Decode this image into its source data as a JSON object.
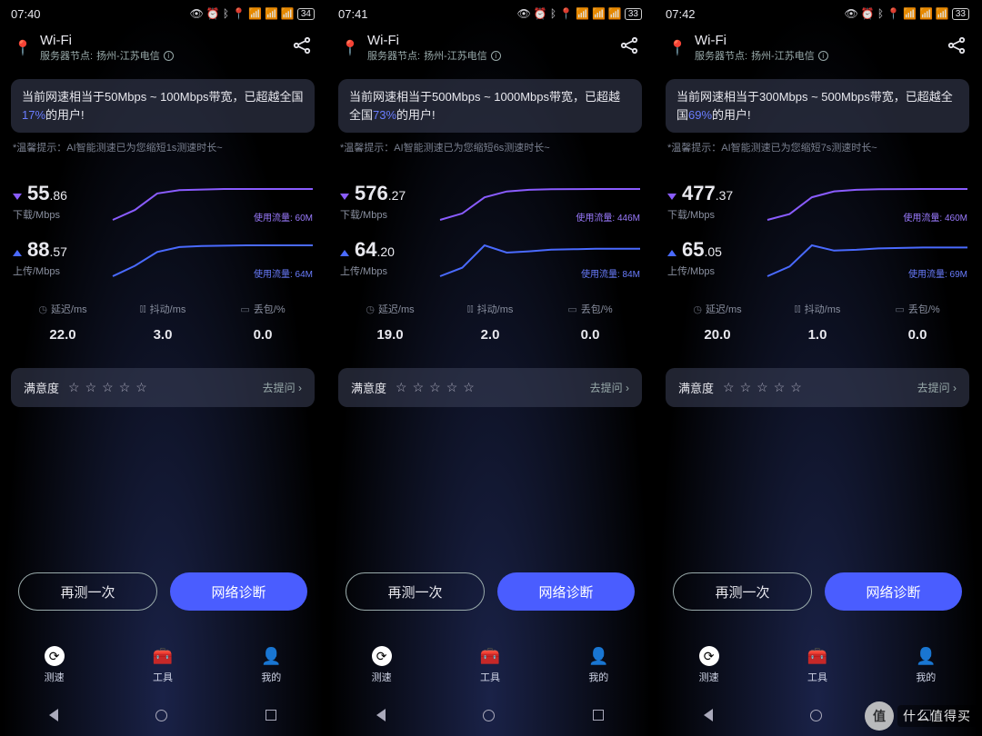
{
  "watermark": {
    "badge": "值",
    "text": "什么值得买"
  },
  "common": {
    "wifi_title": "Wi-Fi",
    "server_prefix": "服务器节点:",
    "download_label": "下载/Mbps",
    "upload_label": "上传/Mbps",
    "usage_prefix": "使用流量:",
    "latency_label": "延迟/ms",
    "jitter_label": "抖动/ms",
    "loss_label": "丢包/%",
    "rating_label": "满意度",
    "ask_label": "去提问 ›",
    "retest_label": "再测一次",
    "diagnose_label": "网络诊断",
    "tab_speed": "测速",
    "tab_tools": "工具",
    "tab_mine": "我的",
    "tip_prefix": "*温馨提示：AI智能测速已为您缩短",
    "tip_suffix": "测速时长~"
  },
  "panels": [
    {
      "time": "07:40",
      "battery": "34",
      "server": "扬州-江苏电信",
      "banner_a": "当前网速相当于50Mbps ~ 100Mbps带宽，已超越全国",
      "banner_pct": "17%",
      "banner_b": "的用户!",
      "tip_duration": "1s",
      "dl_int": "55",
      "dl_dec": ".86",
      "dl_usage": "60M",
      "ul_int": "88",
      "ul_dec": ".57",
      "ul_usage": "64M",
      "latency": "22.0",
      "jitter": "3.0",
      "loss": "0.0"
    },
    {
      "time": "07:41",
      "battery": "33",
      "server": "扬州-江苏电信",
      "banner_a": "当前网速相当于500Mbps ~ 1000Mbps带宽，已超越全国",
      "banner_pct": "73%",
      "banner_b": "的用户!",
      "tip_duration": "6s",
      "dl_int": "576",
      "dl_dec": ".27",
      "dl_usage": "446M",
      "ul_int": "64",
      "ul_dec": ".20",
      "ul_usage": "84M",
      "latency": "19.0",
      "jitter": "2.0",
      "loss": "0.0"
    },
    {
      "time": "07:42",
      "battery": "33",
      "server": "扬州-江苏电信",
      "banner_a": "当前网速相当于300Mbps ~ 500Mbps带宽，已超越全国",
      "banner_pct": "69%",
      "banner_b": "的用户!",
      "tip_duration": "7s",
      "dl_int": "477",
      "dl_dec": ".37",
      "dl_usage": "460M",
      "ul_int": "65",
      "ul_dec": ".05",
      "ul_usage": "69M",
      "latency": "20.0",
      "jitter": "1.0",
      "loss": "0.0"
    }
  ],
  "chart_data": [
    {
      "type": "line",
      "series": [
        {
          "name": "下载/Mbps",
          "values": [
            0,
            18,
            48,
            54,
            55,
            56,
            56,
            56,
            56,
            56
          ]
        },
        {
          "name": "上传/Mbps",
          "values": [
            0,
            30,
            70,
            84,
            87,
            88,
            89,
            89,
            89,
            89
          ]
        }
      ],
      "x": [
        0,
        1,
        2,
        3,
        4,
        5,
        6,
        7,
        8,
        9
      ],
      "ylabel": "Mbps"
    },
    {
      "type": "line",
      "series": [
        {
          "name": "下载/Mbps",
          "values": [
            0,
            120,
            420,
            530,
            560,
            572,
            575,
            576,
            576,
            576
          ]
        },
        {
          "name": "上传/Mbps",
          "values": [
            0,
            20,
            72,
            55,
            58,
            62,
            63,
            64,
            64,
            64
          ]
        }
      ],
      "x": [
        0,
        1,
        2,
        3,
        4,
        5,
        6,
        7,
        8,
        9
      ],
      "ylabel": "Mbps"
    },
    {
      "type": "line",
      "series": [
        {
          "name": "下载/Mbps",
          "values": [
            0,
            90,
            350,
            440,
            465,
            474,
            476,
            477,
            477,
            477
          ]
        },
        {
          "name": "上传/Mbps",
          "values": [
            0,
            22,
            70,
            58,
            60,
            63,
            64,
            65,
            65,
            65
          ]
        }
      ],
      "x": [
        0,
        1,
        2,
        3,
        4,
        5,
        6,
        7,
        8,
        9
      ],
      "ylabel": "Mbps"
    }
  ]
}
